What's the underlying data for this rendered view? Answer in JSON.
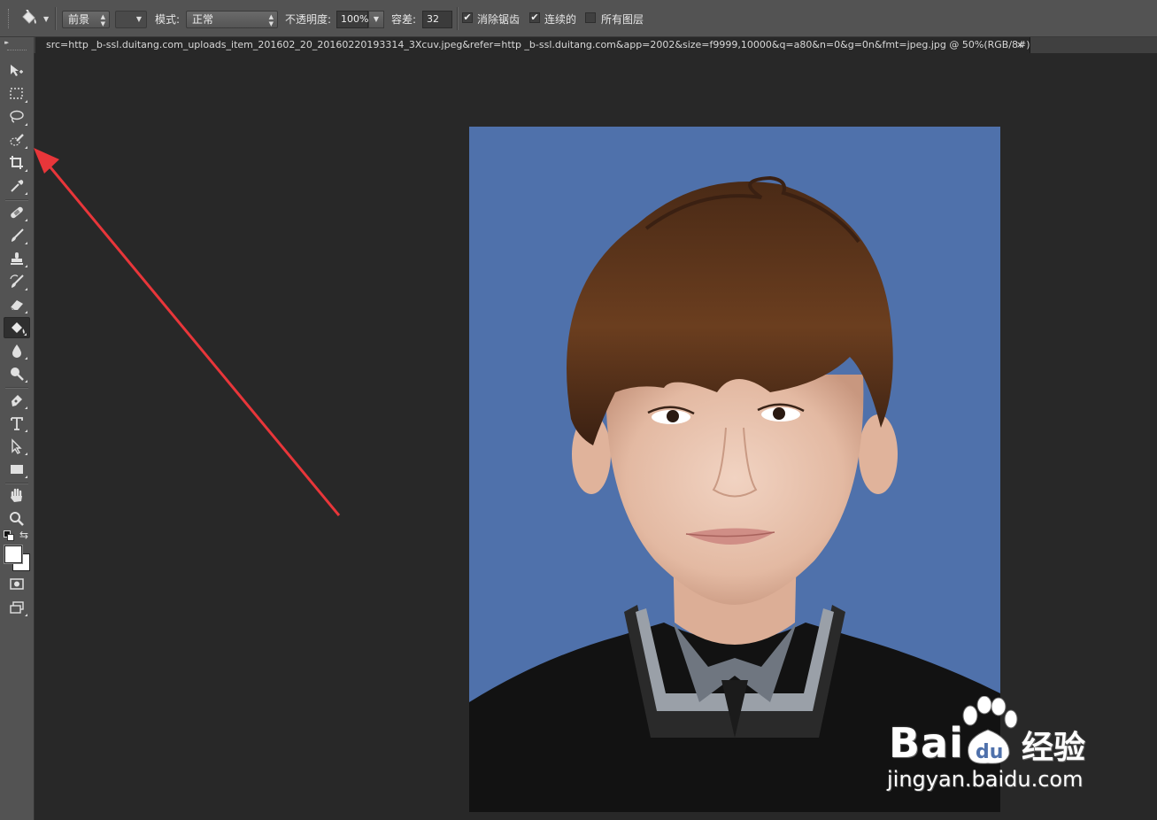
{
  "options_bar": {
    "tool_icon": "paint-bucket-icon",
    "fill_source": "前景",
    "mode_label": "模式:",
    "mode_value": "正常",
    "opacity_label": "不透明度:",
    "opacity_value": "100%",
    "tolerance_label": "容差:",
    "tolerance_value": "32",
    "antialias_label": "消除锯齿",
    "antialias_checked": true,
    "contiguous_label": "连续的",
    "contiguous_checked": true,
    "all_layers_label": "所有图层",
    "all_layers_checked": false,
    "check_mark": "✔"
  },
  "document": {
    "tab_title": "src=http _b-ssl.duitang.com_uploads_item_201602_20_20160220193314_3Xcuv.jpeg&refer=http _b-ssl.duitang.com&app=2002&size=f9999,10000&q=a80&n=0&g=0n&fmt=jpeg.jpg @ 50%(RGB/8#) *",
    "close_glyph": "×"
  },
  "toolbox": {
    "collapse_glyph": "▸▸",
    "tools": [
      {
        "name": "move-icon"
      },
      {
        "name": "marquee-icon"
      },
      {
        "name": "lasso-icon"
      },
      {
        "name": "quick-selection-icon"
      },
      {
        "name": "crop-icon"
      },
      {
        "name": "eyedropper-icon"
      },
      {
        "name": "healing-brush-icon"
      },
      {
        "name": "brush-icon"
      },
      {
        "name": "clone-stamp-icon"
      },
      {
        "name": "history-brush-icon"
      },
      {
        "name": "eraser-icon"
      },
      {
        "name": "paint-bucket-icon",
        "active": true
      },
      {
        "name": "blur-icon"
      },
      {
        "name": "dodge-icon"
      },
      {
        "name": "pen-icon"
      },
      {
        "name": "type-icon"
      },
      {
        "name": "path-selection-icon"
      },
      {
        "name": "rectangle-icon"
      },
      {
        "name": "hand-icon"
      },
      {
        "name": "zoom-icon"
      },
      {
        "name": "quick-mask-icon"
      },
      {
        "name": "screen-mode-icon"
      }
    ],
    "foreground_color": "#ffffff",
    "background_color": "#ffffff"
  },
  "photo": {
    "background_color": "#4f71ab",
    "subject": "portrait"
  },
  "watermark": {
    "brand": "Bai",
    "brand_du": "du",
    "jingyan": "经验",
    "url": "jingyan.baidu.com"
  },
  "annotation": {
    "arrow_color": "#e8363a"
  }
}
